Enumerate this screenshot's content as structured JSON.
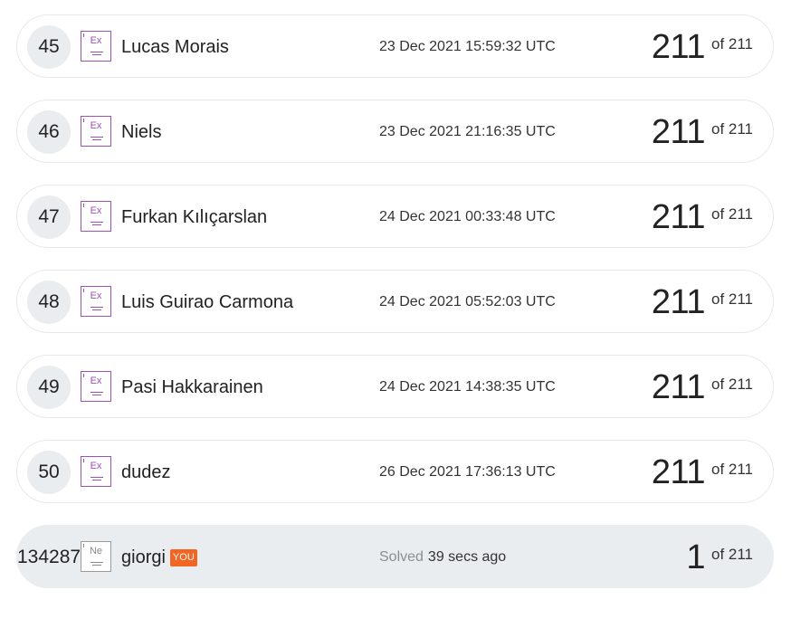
{
  "leaderboard": {
    "rows": [
      {
        "rank": "45",
        "badge": "Ex",
        "name": "Lucas Morais",
        "time": "23 Dec 2021 15:59:32 UTC",
        "score": "211",
        "total": "of 211"
      },
      {
        "rank": "46",
        "badge": "Ex",
        "name": "Niels",
        "time": "23 Dec 2021 21:16:35 UTC",
        "score": "211",
        "total": "of 211"
      },
      {
        "rank": "47",
        "badge": "Ex",
        "name": "Furkan Kılıçarslan",
        "time": "24 Dec 2021 00:33:48 UTC",
        "score": "211",
        "total": "of 211"
      },
      {
        "rank": "48",
        "badge": "Ex",
        "name": "Luis Guirao Carmona",
        "time": "24 Dec 2021 05:52:03 UTC",
        "score": "211",
        "total": "of 211"
      },
      {
        "rank": "49",
        "badge": "Ex",
        "name": "Pasi Hakkarainen",
        "time": "24 Dec 2021 14:38:35 UTC",
        "score": "211",
        "total": "of 211"
      },
      {
        "rank": "50",
        "badge": "Ex",
        "name": "dudez",
        "time": "26 Dec 2021 17:36:13 UTC",
        "score": "211",
        "total": "of 211"
      }
    ],
    "current_user": {
      "rank": "134287",
      "badge": "Ne",
      "name": "giorgi",
      "you_label": "YOU",
      "solved_label": "Solved",
      "time": "39 secs ago",
      "score": "1",
      "total": "of 211"
    }
  },
  "colors": {
    "expert_badge": "#9a52b8",
    "newbie_badge": "#9a9a9a",
    "you_tag": "#f26522",
    "row_highlight": "#e9edf0"
  }
}
